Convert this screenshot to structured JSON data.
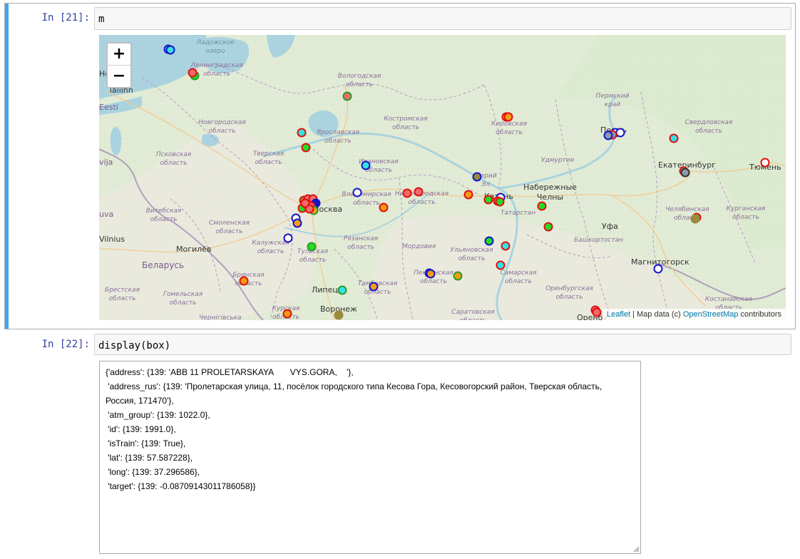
{
  "cell21": {
    "prompt": "In [21]:",
    "code": "m"
  },
  "map": {
    "zoom_in": "+",
    "zoom_out": "−",
    "attribution": {
      "leaflet": "Leaflet",
      "sep": " | Map data (c) ",
      "osm": "OpenStreetMap",
      "contributors": " contributors"
    },
    "labels": {
      "ladoga": "Ладожское озеро",
      "leningrad": "Ленинградская область",
      "helsinki": "Helsi",
      "tallinn": "Tallinn",
      "eesti": "Eesti",
      "vologda": "Вологодская область",
      "kostroma": "Костромская область",
      "kirov": "Кировская область",
      "perm_krai": "Пермский край",
      "perm": "Пермь",
      "sverdlovsk": "Свердловская область",
      "novgorod": "Новгородская область",
      "yaroslavl": "Ярославская область",
      "pskov": "Псковская область",
      "tver": "Тверская область",
      "ivanovo": "Ивановская область",
      "udmurtia": "Удмуртия",
      "ekaterinburg": "Екатеринбург",
      "tyumen": "Тюмень",
      "latvija": "vija",
      "vladimir": "Владимирская область",
      "nizhny": "Нижегородская область",
      "mari": "Марий Эл",
      "kazan": "Казань",
      "naberezhnye": "Набережные Челны",
      "tatarstan": "Татарстан",
      "vitebsk": "Витебская область",
      "smolensk": "Смоленская область",
      "moscow": "Москва",
      "chelyabinsk": "Челябинская область",
      "kurgan": "Курганская область",
      "lietuva": "uva",
      "vilnius": "Vilnius",
      "kaluga": "Калужская область",
      "ryazan": "Рязанская область",
      "ufa": "Уфа",
      "mogilev": "Могилёв",
      "tula": "Тульская область",
      "mordovia": "Мордовия",
      "ulyanovsk": "Ульяновская область",
      "bashkortostan": "Башкортостан",
      "belarus": "Беларусь",
      "magnitogorsk": "Магнитогорск",
      "bryansk": "Брянская область",
      "penza": "Пензенская область",
      "samara": "Самарская область",
      "brest": "Брестская область",
      "gomel": "Гомельская область",
      "lipetsk": "Липецк",
      "tambov": "Тамбовская область",
      "orenburg_obl": "Оренбургская область",
      "kostanay": "Костанайская область",
      "kursk": "Курская область",
      "voronezh": "Воронеж",
      "chernigov": "Чернігівська",
      "saratov": "Саратовская область",
      "orenburg": "Оренбу"
    },
    "marker_colors": {
      "red": "#e01010",
      "blue": "#1515c8",
      "green": "#2a9a2a",
      "orange": "#f39c12",
      "cyan": "#33e3e3",
      "lime": "#22dd22",
      "pink": "#f26b6b",
      "olive": "#9a8c3c",
      "steel": "#8a9aaa"
    }
  },
  "cell22": {
    "prompt": "In [22]:",
    "code": "display(box)"
  },
  "output": {
    "lines": [
      "{'address': {139: 'ABB 11 PROLETARSKAYA       VYS.GORA,    '},",
      " 'address_rus': {139: 'Пролетарская улица, 11, посёлок городского типа Кесова Гора, Кесовогорский район, Тверская область, Россия, 171470'},",
      " 'atm_group': {139: 1022.0},",
      " 'id': {139: 1991.0},",
      " 'isTrain': {139: True},",
      " 'lat': {139: 57.587228},",
      " 'long': {139: 37.296586},",
      " 'target': {139: -0.08709143011786058}}"
    ]
  }
}
